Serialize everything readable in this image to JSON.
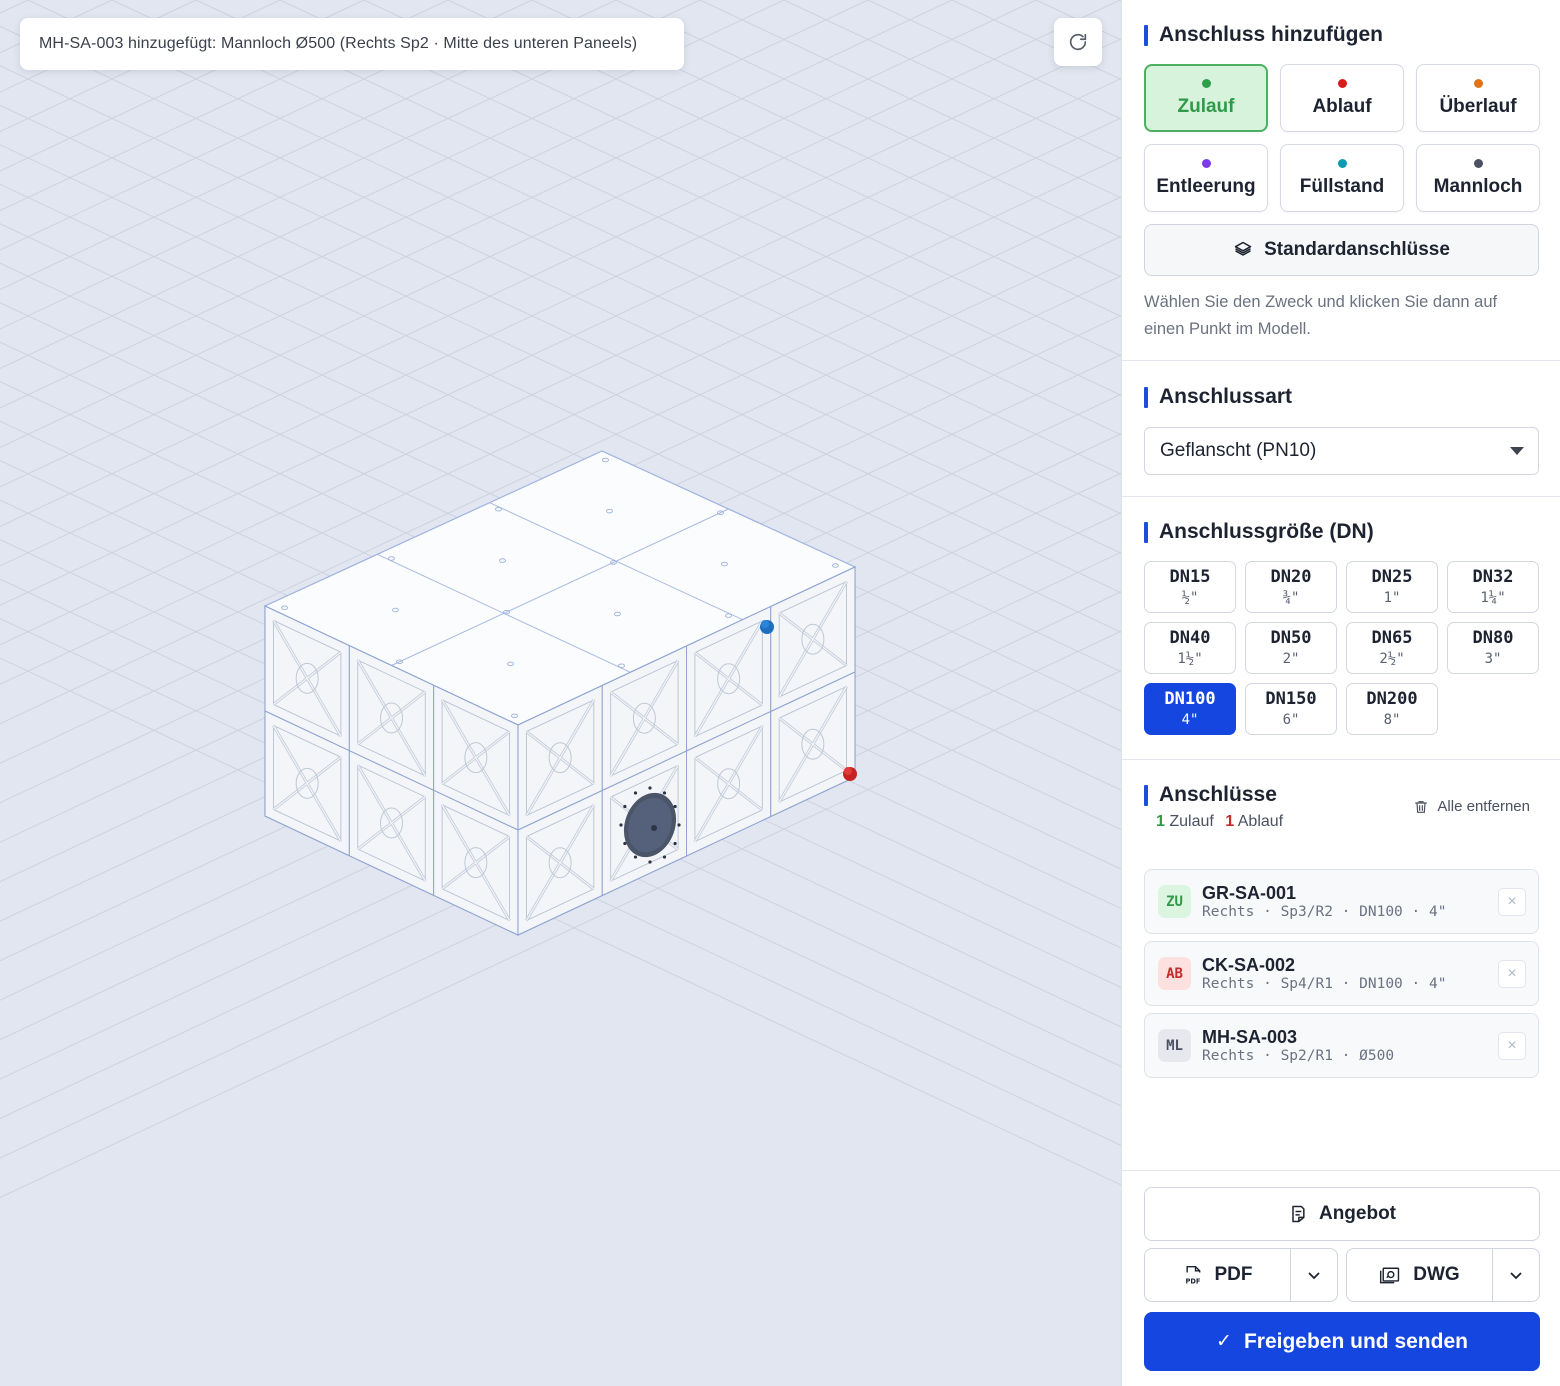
{
  "toast": {
    "message": "MH-SA-003 hinzugefügt: Mannloch Ø500 (Rechts Sp2 · Mitte des unteren Paneels)"
  },
  "viewport": {
    "reset_icon": "refresh-icon"
  },
  "add_connection": {
    "title": "Anschluss hinzufügen",
    "purposes": [
      {
        "label": "Zulauf",
        "color": "#2e9e4a",
        "active": true
      },
      {
        "label": "Ablauf",
        "color": "#d81b1b",
        "active": false
      },
      {
        "label": "Überlauf",
        "color": "#e0731a",
        "active": false
      },
      {
        "label": "Entleerung",
        "color": "#7c3aed",
        "active": false
      },
      {
        "label": "Füllstand",
        "color": "#0e9bb0",
        "active": false
      },
      {
        "label": "Mannloch",
        "color": "#4b5160",
        "active": false
      }
    ],
    "standard_button": "Standardanschlüsse",
    "hint": "Wählen Sie den Zweck und klicken Sie dann auf einen Punkt im Modell."
  },
  "connection_type": {
    "title": "Anschlussart",
    "selected": "Geflanscht (PN10)"
  },
  "connection_size": {
    "title": "Anschlussgröße (DN)",
    "sizes": [
      {
        "dn": "DN15",
        "inch": "½\"",
        "active": false
      },
      {
        "dn": "DN20",
        "inch": "¾\"",
        "active": false
      },
      {
        "dn": "DN25",
        "inch": "1\"",
        "active": false
      },
      {
        "dn": "DN32",
        "inch": "1¼\"",
        "active": false
      },
      {
        "dn": "DN40",
        "inch": "1½\"",
        "active": false
      },
      {
        "dn": "DN50",
        "inch": "2\"",
        "active": false
      },
      {
        "dn": "DN65",
        "inch": "2½\"",
        "active": false
      },
      {
        "dn": "DN80",
        "inch": "3\"",
        "active": false
      },
      {
        "dn": "DN100",
        "inch": "4\"",
        "active": true
      },
      {
        "dn": "DN150",
        "inch": "6\"",
        "active": false
      },
      {
        "dn": "DN200",
        "inch": "8\"",
        "active": false
      }
    ]
  },
  "connections": {
    "title": "Anschlüsse",
    "count_zulauf": "1",
    "label_zulauf": "Zulauf",
    "count_ablauf": "1",
    "label_ablauf": "Ablauf",
    "remove_all": "Alle entfernen",
    "items": [
      {
        "badge": "ZU",
        "badge_bg": "#dcf5e1",
        "badge_fg": "#2f9a49",
        "id": "GR-SA-001",
        "meta": "Rechts · Sp3/R2 · DN100 · 4\""
      },
      {
        "badge": "AB",
        "badge_bg": "#fde0e0",
        "badge_fg": "#c72a2a",
        "id": "CK-SA-002",
        "meta": "Rechts · Sp4/R1 · DN100 · 4\""
      },
      {
        "badge": "ML",
        "badge_bg": "#e6e8ee",
        "badge_fg": "#4b5160",
        "id": "MH-SA-003",
        "meta": "Rechts · Sp2/R1 · Ø500"
      }
    ]
  },
  "footer": {
    "quote": "Angebot",
    "pdf": "PDF",
    "dwg": "DWG",
    "submit": "Freigeben und senden"
  }
}
